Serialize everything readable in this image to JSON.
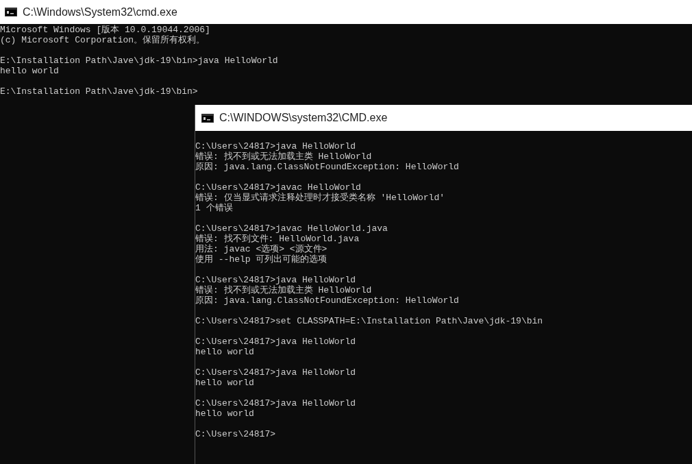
{
  "windows": [
    {
      "title": "C:\\Windows\\System32\\cmd.exe",
      "blocks": [
        [
          "Microsoft Windows [版本 10.0.19044.2006]",
          "(c) Microsoft Corporation。保留所有权利。"
        ],
        [
          "E:\\Installation Path\\Jave\\jdk-19\\bin>java HelloWorld",
          "hello world"
        ],
        [
          "E:\\Installation Path\\Jave\\jdk-19\\bin>"
        ]
      ]
    },
    {
      "title": "C:\\WINDOWS\\system32\\CMD.exe",
      "blocks": [
        [
          "C:\\Users\\24817>java HelloWorld",
          "错误: 找不到或无法加载主类 HelloWorld",
          "原因: java.lang.ClassNotFoundException: HelloWorld"
        ],
        [
          "C:\\Users\\24817>javac HelloWorld",
          "错误: 仅当显式请求注释处理时才接受类名称 'HelloWorld'",
          "1 个错误"
        ],
        [
          "C:\\Users\\24817>javac HelloWorld.java",
          "错误: 找不到文件: HelloWorld.java",
          "用法: javac <选项> <源文件>",
          "使用 --help 可列出可能的选项"
        ],
        [
          "C:\\Users\\24817>java HelloWorld",
          "错误: 找不到或无法加载主类 HelloWorld",
          "原因: java.lang.ClassNotFoundException: HelloWorld"
        ],
        [
          "C:\\Users\\24817>set CLASSPATH=E:\\Installation Path\\Jave\\jdk-19\\bin"
        ],
        [
          "C:\\Users\\24817>java HelloWorld",
          "hello world"
        ],
        [
          "C:\\Users\\24817>java HelloWorld",
          "hello world"
        ],
        [
          "C:\\Users\\24817>java HelloWorld",
          "hello world"
        ],
        [
          "C:\\Users\\24817>"
        ]
      ]
    }
  ]
}
